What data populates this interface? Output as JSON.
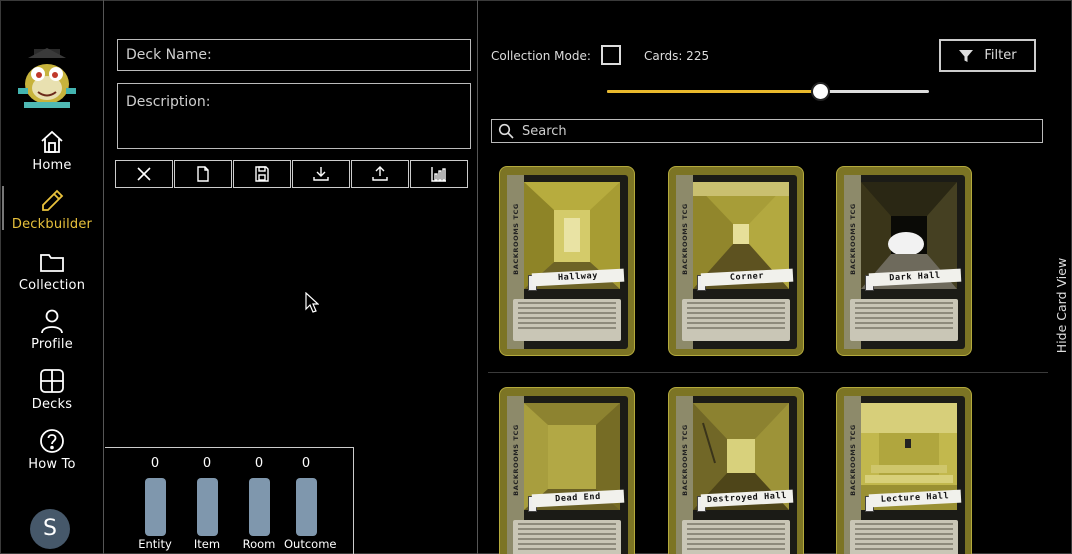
{
  "sidebar": {
    "items": [
      {
        "label": "Home",
        "icon": "home-icon"
      },
      {
        "label": "Deckbuilder",
        "icon": "pencil-icon",
        "active": true
      },
      {
        "label": "Collection",
        "icon": "folder-icon"
      },
      {
        "label": "Profile",
        "icon": "user-icon"
      },
      {
        "label": "Decks",
        "icon": "grid-icon"
      },
      {
        "label": "How To",
        "icon": "help-icon"
      }
    ],
    "avatar_initial": "S",
    "accent_color": "#e9c23c"
  },
  "deck": {
    "name_placeholder": "Deck Name:",
    "description_placeholder": "Description:",
    "toolbar": [
      "clear-icon",
      "new-file-icon",
      "save-icon",
      "download-icon",
      "upload-icon",
      "stats-icon"
    ]
  },
  "stats": [
    {
      "label": "Entity",
      "count": "0"
    },
    {
      "label": "Item",
      "count": "0"
    },
    {
      "label": "Room",
      "count": "0"
    },
    {
      "label": "Outcome",
      "count": "0"
    }
  ],
  "collection": {
    "mode_label": "Collection Mode:",
    "mode_checked": false,
    "cards_label": "Cards: 225",
    "filter_label": "Filter",
    "slider_value": 0.66,
    "search_placeholder": "Search",
    "hide_view_label": "Hide Card View"
  },
  "cards": [
    {
      "title": "Hallway",
      "side": "BACKROOMS TCG",
      "scene": "hall"
    },
    {
      "title": "Corner",
      "side": "BACKROOMS TCG",
      "scene": "corridor"
    },
    {
      "title": "Dark Hall",
      "side": "BACKROOMS TCG",
      "scene": "dark"
    },
    {
      "title": "Dead End",
      "side": "BACKROOMS TCG",
      "scene": "deadend"
    },
    {
      "title": "Destroyed Hall",
      "side": "BACKROOMS TCG",
      "scene": "destroyed"
    },
    {
      "title": "Lecture Hall",
      "side": "BACKROOMS TCG",
      "scene": "lecture"
    }
  ]
}
